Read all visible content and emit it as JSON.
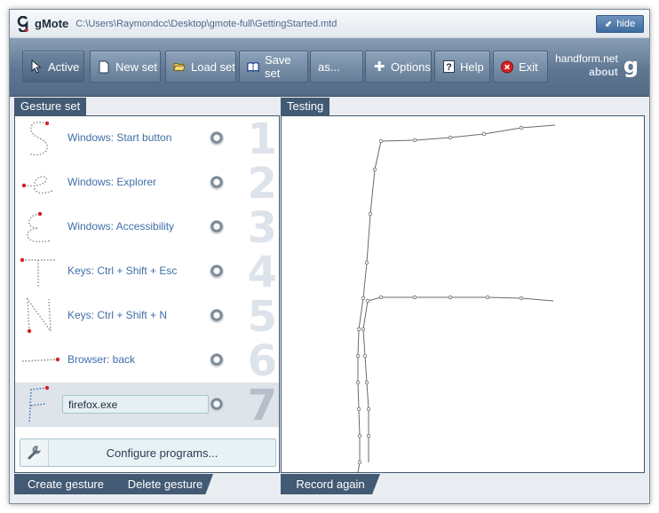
{
  "app": {
    "name": "gMote",
    "path": "C:\\Users\\Raymondcc\\Desktop\\gmote-full\\GettingStarted.mtd",
    "hide_label": "hide"
  },
  "toolbar": {
    "active": "Active",
    "new_set": "New set",
    "load_set": "Load set",
    "save_set": "Save set",
    "save_as": "as...",
    "options": "Options",
    "help": "Help",
    "exit": "Exit",
    "brand": "handform.net",
    "about": "about",
    "brand_logo": "g"
  },
  "gesture_panel": {
    "title": "Gesture set",
    "gestures": [
      {
        "number": "1",
        "label": "Windows: Start button"
      },
      {
        "number": "2",
        "label": "Windows: Explorer"
      },
      {
        "number": "3",
        "label": "Windows: Accessibility"
      },
      {
        "number": "4",
        "label": "Keys: Ctrl + Shift + Esc"
      },
      {
        "number": "5",
        "label": "Keys: Ctrl + Shift + N"
      },
      {
        "number": "6",
        "label": "Browser: back"
      },
      {
        "number": "7",
        "label": "firefox.exe"
      }
    ],
    "configure": "Configure programs..."
  },
  "testing_panel": {
    "title": "Testing"
  },
  "buttons": {
    "create": "Create gesture",
    "delete": "Delete gesture",
    "record": "Record again"
  },
  "colors": {
    "accent_dark": "#425a73",
    "toolbar": "#647c96",
    "link_blue": "#3f6fa8"
  }
}
